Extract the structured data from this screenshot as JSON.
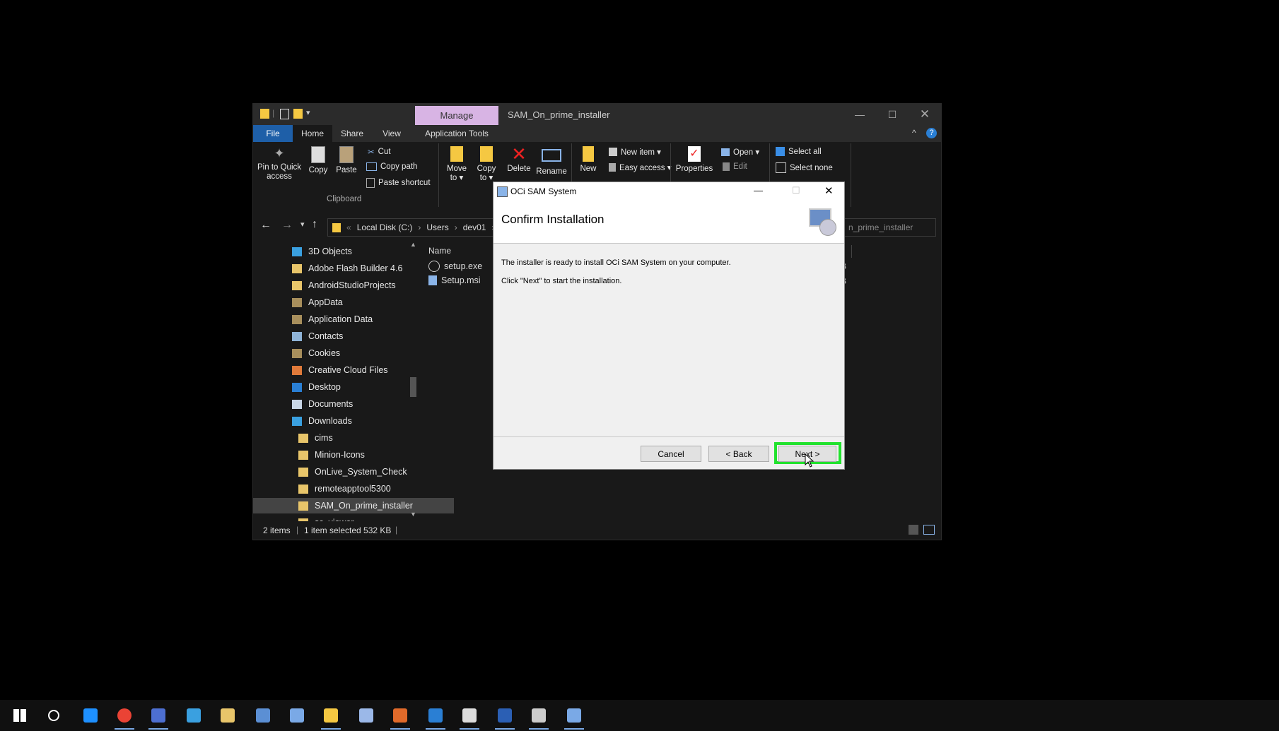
{
  "explorer": {
    "title": "SAM_On_prime_installer",
    "manage_tab": "Manage",
    "tabs": [
      "File",
      "Home",
      "Share",
      "View",
      "Application Tools"
    ],
    "ribbon": {
      "pin_label_1": "Pin to Quick",
      "pin_label_2": "access",
      "copy": "Copy",
      "paste": "Paste",
      "cut": "Cut",
      "copy_path": "Copy path",
      "paste_shortcut": "Paste shortcut",
      "clipboard_group": "Clipboard",
      "move_to_1": "Move",
      "move_to_2": "to ▾",
      "copy_to_1": "Copy",
      "copy_to_2": "to ▾",
      "delete": "Delete",
      "rename": "Rename",
      "new": "New",
      "new_item": "New item ▾",
      "easy_access": "Easy access ▾",
      "properties": "Properties",
      "open": "Open ▾",
      "edit": "Edit",
      "select_all": "Select all",
      "select_none": "Select none"
    },
    "address": {
      "path": [
        "Local Disk (C:)",
        "Users",
        "dev01"
      ],
      "search_text": "n_prime_installer"
    },
    "tree": [
      {
        "label": "3D Objects",
        "color": "#3aa0e0"
      },
      {
        "label": "Adobe Flash Builder 4.6",
        "color": "#e8c56a"
      },
      {
        "label": "AndroidStudioProjects",
        "color": "#e8c56a"
      },
      {
        "label": "AppData",
        "color": "#a88f5c"
      },
      {
        "label": "Application Data",
        "color": "#a88f5c"
      },
      {
        "label": "Contacts",
        "color": "#8fb4d8"
      },
      {
        "label": "Cookies",
        "color": "#a88f5c"
      },
      {
        "label": "Creative Cloud Files",
        "color": "#e07a3a"
      },
      {
        "label": "Desktop",
        "color": "#2a7fd4"
      },
      {
        "label": "Documents",
        "color": "#c9d6e6"
      },
      {
        "label": "Downloads",
        "color": "#3aa0e0"
      },
      {
        "label": "cims",
        "color": "#e8c56a"
      },
      {
        "label": "Minion-Icons",
        "color": "#e8c56a"
      },
      {
        "label": "OnLive_System_Check",
        "color": "#e8c56a"
      },
      {
        "label": "remoteapptool5300",
        "color": "#e8c56a"
      },
      {
        "label": "SAM_On_prime_installer",
        "color": "#e8c56a"
      },
      {
        "label": "sc_viewer",
        "color": "#e8c56a"
      }
    ],
    "column_name": "Name",
    "files": [
      "setup.exe",
      "Setup.msi"
    ],
    "file_size_suffix": "B",
    "status": {
      "items": "2 items",
      "selected": "1 item selected  532 KB"
    }
  },
  "dialog": {
    "title": "OCi SAM System",
    "heading": "Confirm Installation",
    "line1": "The installer is ready to install OCi SAM System on your computer.",
    "line2": "Click \"Next\" to start the installation.",
    "cancel": "Cancel",
    "back": "< Back",
    "next": "Next >",
    "highlight_color": "#22e22e"
  },
  "taskbar": {
    "icons": [
      "start-icon",
      "search-icon",
      "edge-icon",
      "chrome-icon",
      "password-manager-icon",
      "network-icon",
      "tools-icon",
      "task-manager-icon",
      "remote-desktop-icon",
      "file-explorer-icon",
      "paint-icon",
      "office-icon",
      "oci-icon",
      "acrobat-icon",
      "word-icon",
      "outlook-icon",
      "installer-icon"
    ]
  }
}
